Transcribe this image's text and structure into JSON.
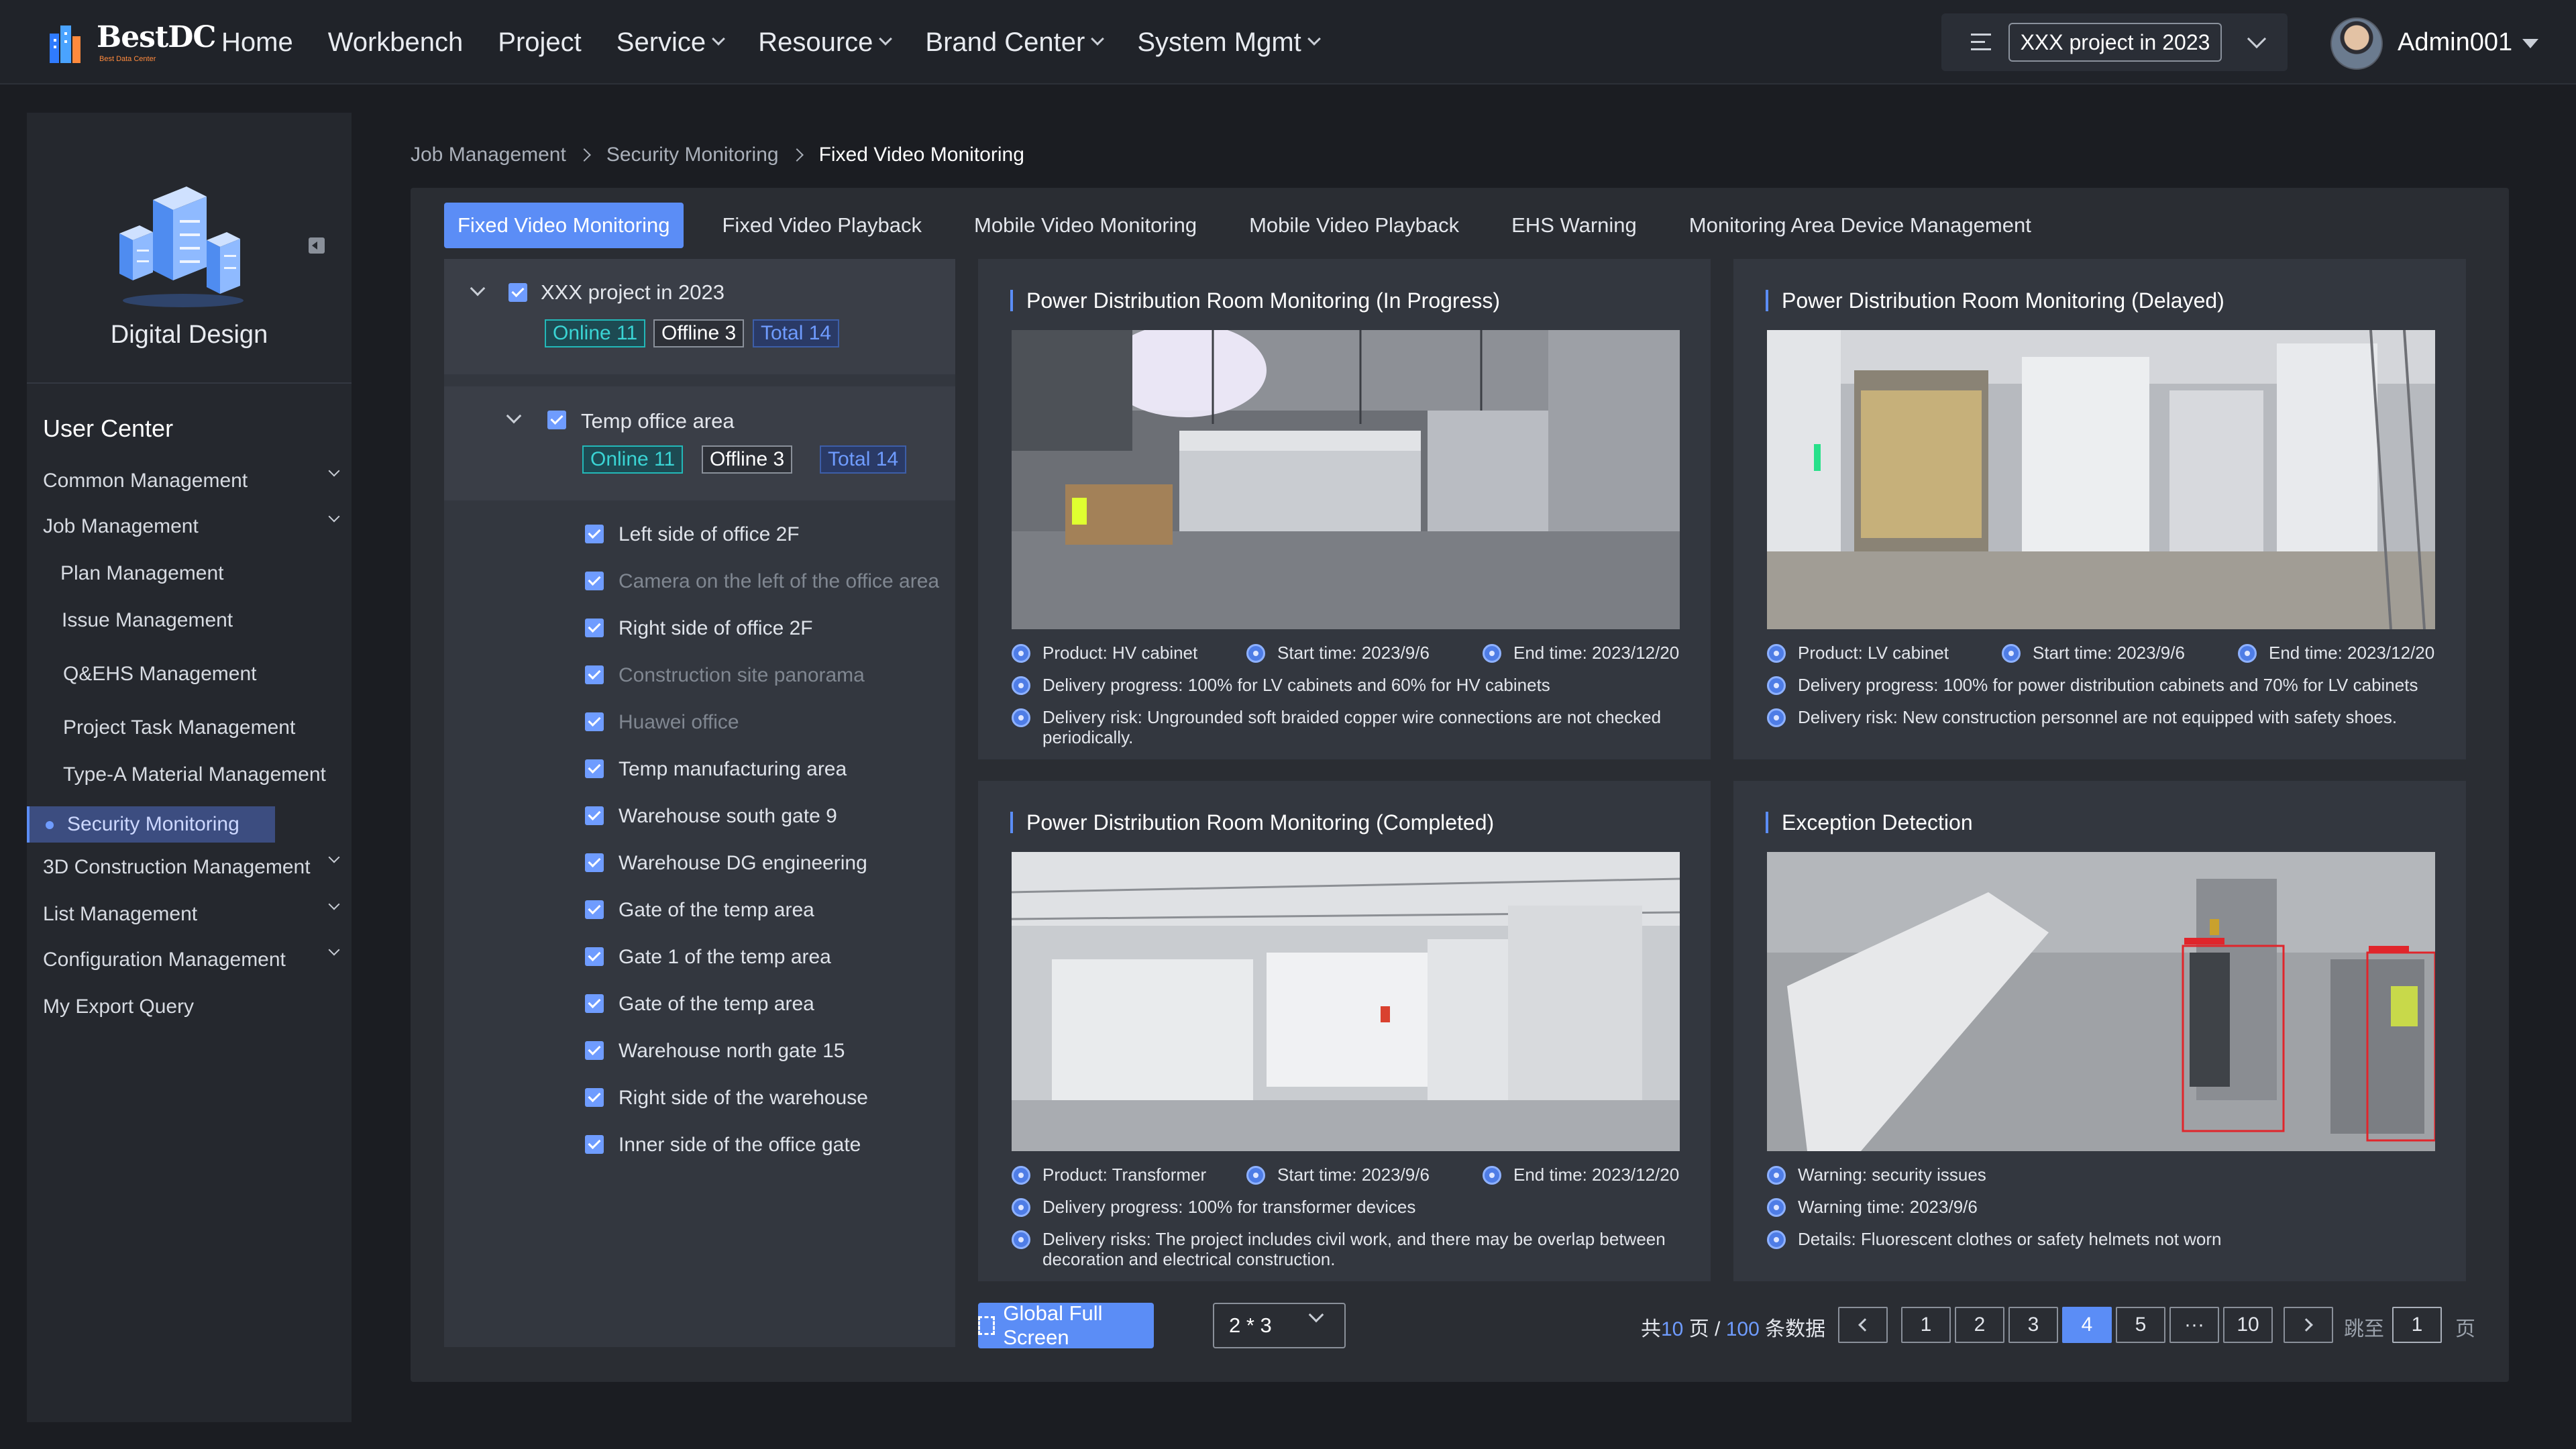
{
  "header": {
    "logo_text": "BestDC",
    "logo_sub": "Best Data Center",
    "nav": [
      {
        "label": "Home",
        "dropdown": false
      },
      {
        "label": "Workbench",
        "dropdown": false
      },
      {
        "label": "Project",
        "dropdown": false
      },
      {
        "label": "Service",
        "dropdown": true
      },
      {
        "label": "Resource",
        "dropdown": true
      },
      {
        "label": "Brand Center",
        "dropdown": true
      },
      {
        "label": "System Mgmt",
        "dropdown": true
      }
    ],
    "project_selector": "XXX project in 2023",
    "user": "Admin001"
  },
  "sidebar": {
    "brand": "Digital Design",
    "section": "User Center",
    "items": [
      {
        "label": "Common Management",
        "expandable": true
      },
      {
        "label": "Job Management",
        "expandable": true,
        "expanded": true
      },
      {
        "label": "3D Construction Management",
        "expandable": true
      },
      {
        "label": "List Management",
        "expandable": true
      },
      {
        "label": "Configuration Management",
        "expandable": true
      },
      {
        "label": "My Export Query",
        "expandable": false
      }
    ],
    "sub_items": [
      "Plan Management",
      "Issue Management",
      "Q&EHS Management",
      "Project Task Management",
      "Type-A Material Management",
      "Security Monitoring"
    ],
    "active": "Security Monitoring"
  },
  "breadcrumb": [
    "Job Management",
    "Security Monitoring",
    "Fixed Video Monitoring"
  ],
  "tabs": [
    "Fixed Video Monitoring",
    "Fixed Video Playback",
    "Mobile Video Monitoring",
    "Mobile Video Playback",
    "EHS Warning",
    "Monitoring Area Device Management"
  ],
  "active_tab": "Fixed Video Monitoring",
  "tree": {
    "root": {
      "label": "XXX project in 2023",
      "online": "Online 11",
      "offline": "Offline 3",
      "total": "Total 14"
    },
    "area": {
      "label": "Temp office area",
      "online": "Online 11",
      "offline": "Offline 3",
      "total": "Total 14"
    },
    "cameras": [
      {
        "label": "Left side of office 2F",
        "online": true
      },
      {
        "label": "Camera on the left of the office area",
        "online": false
      },
      {
        "label": "Right side of office 2F",
        "online": true
      },
      {
        "label": "Construction site panorama",
        "online": false
      },
      {
        "label": "Huawei office",
        "online": false
      },
      {
        "label": "Temp manufacturing area",
        "online": true
      },
      {
        "label": "Warehouse south gate 9",
        "online": true
      },
      {
        "label": "Warehouse DG engineering",
        "online": true
      },
      {
        "label": "Gate of the temp area",
        "online": true
      },
      {
        "label": "Gate 1 of the temp area",
        "online": true
      },
      {
        "label": "Gate of the temp area",
        "online": true
      },
      {
        "label": "Warehouse north gate 15",
        "online": true
      },
      {
        "label": "Right side of the warehouse",
        "online": true
      },
      {
        "label": "Inner side of the office gate",
        "online": true
      }
    ]
  },
  "cards": [
    {
      "title": "Power Distribution Room Monitoring (In Progress)",
      "product": "Product: HV cabinet",
      "start": "Start time: 2023/9/6",
      "end": "End time: 2023/12/20",
      "line2": "Delivery progress: 100% for LV cabinets and 60% for HV cabinets",
      "line3": "Delivery risk: Ungrounded soft braided copper wire connections are not checked periodically."
    },
    {
      "title": "Power Distribution Room Monitoring (Delayed)",
      "product": "Product: LV cabinet",
      "start": "Start time: 2023/9/6",
      "end": "End time: 2023/12/20",
      "line2": "Delivery progress: 100% for power distribution cabinets and 70% for LV cabinets",
      "line3": "Delivery risk: New construction personnel are not equipped with safety shoes."
    },
    {
      "title": "Power Distribution Room Monitoring (Completed)",
      "product": "Product: Transformer",
      "start": "Start time: 2023/9/6",
      "end": "End time: 2023/12/20",
      "line2": "Delivery progress: 100% for transformer devices",
      "line3": "Delivery risks: The project includes civil work, and there may be overlap between decoration and electrical construction."
    },
    {
      "title": "Exception Detection",
      "line1": "Warning: security issues",
      "line2": "Warning time: 2023/9/6",
      "line3": "Details: Fluorescent clothes or safety helmets not worn"
    }
  ],
  "footer": {
    "full_screen": "Global Full Screen",
    "layout": "2 * 3",
    "total_prefix": "共",
    "pages": "10",
    "pages_unit": "页 /",
    "records": "100",
    "records_unit": "条数据",
    "page_buttons": [
      "1",
      "2",
      "3",
      "4",
      "5",
      "···",
      "10"
    ],
    "current_page": "4",
    "jump_label": "跳至",
    "jump_value": "1",
    "jump_unit": "页"
  },
  "colors": {
    "accent": "#5b8df6",
    "online": "#3ad4d4",
    "background": "#1b1d22",
    "panel": "#2a2d33"
  }
}
